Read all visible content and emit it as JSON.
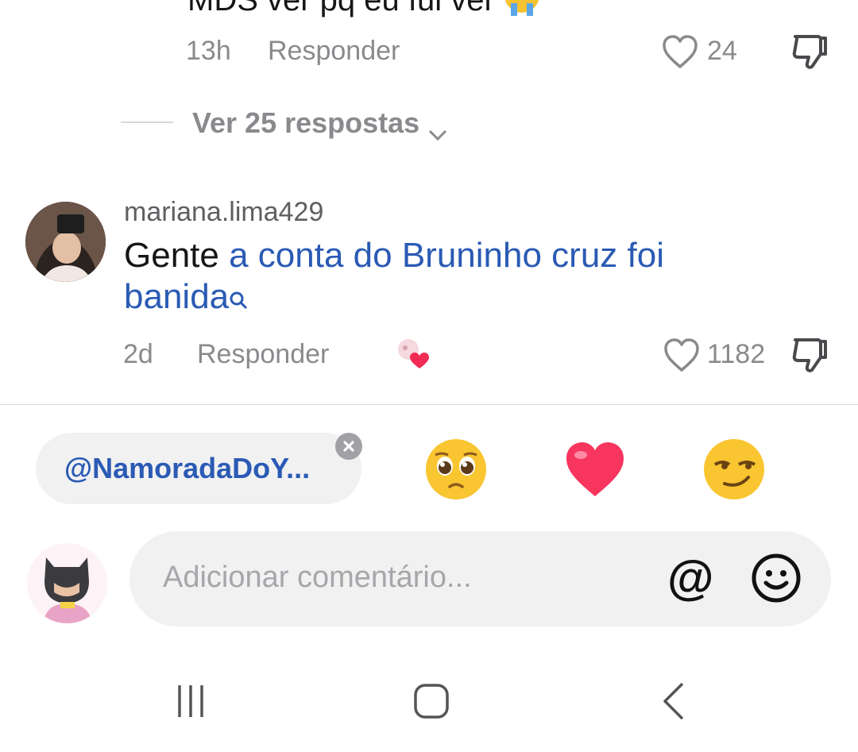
{
  "previous_comment": {
    "text_partial": "MDS ver pq eu fui ver",
    "time": "13h",
    "reply_label": "Responder",
    "likes": "24"
  },
  "replies": {
    "label": "Ver 25 respostas"
  },
  "comment": {
    "username": "mariana.lima429",
    "text_plain": "Gente ",
    "text_link": "a conta do Bruninho cruz foi banida",
    "time": "2d",
    "reply_label": "Responder",
    "likes": "1182"
  },
  "composer": {
    "mention_chip": "@NamoradaDoY...",
    "placeholder": "Adicionar comentário...",
    "at_symbol": "@",
    "quick_emojis": [
      "pleading-face",
      "red-heart",
      "smirking-face"
    ]
  },
  "colors": {
    "link": "#2a5ab4",
    "muted": "#8a8a8e",
    "like_icon": "#8a8a8e"
  },
  "navbar": {
    "buttons": [
      "recent-apps-icon",
      "home-icon",
      "back-icon"
    ]
  }
}
